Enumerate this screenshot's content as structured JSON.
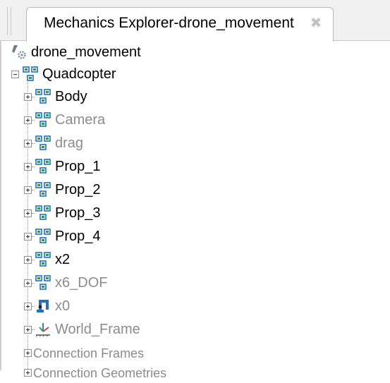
{
  "tab": {
    "title": "Mechanics Explorer-drone_movement",
    "close_glyph": "✖"
  },
  "tree": {
    "root": {
      "label": "drone_movement",
      "icon": "model-gear-icon"
    },
    "group": {
      "label": "Quadcopter",
      "icon": "subsystem-icon",
      "expanded": true
    },
    "children": [
      {
        "label": "Body",
        "icon": "subsystem-icon",
        "active": true
      },
      {
        "label": "Camera",
        "icon": "subsystem-icon",
        "active": false
      },
      {
        "label": "drag",
        "icon": "subsystem-icon",
        "active": false
      },
      {
        "label": "Prop_1",
        "icon": "subsystem-icon",
        "active": true
      },
      {
        "label": "Prop_2",
        "icon": "subsystem-icon",
        "active": true
      },
      {
        "label": "Prop_3",
        "icon": "subsystem-icon",
        "active": true
      },
      {
        "label": "Prop_4",
        "icon": "subsystem-icon",
        "active": true
      },
      {
        "label": "x2",
        "icon": "subsystem-icon",
        "active": true
      },
      {
        "label": "x6_DOF",
        "icon": "subsystem-icon",
        "active": false
      },
      {
        "label": "x0",
        "icon": "robot-arm-icon",
        "active": false
      },
      {
        "label": "World_Frame",
        "icon": "world-frame-icon",
        "active": false
      }
    ],
    "folders": [
      {
        "label": "Connection Frames"
      },
      {
        "label": "Connection Geometries"
      }
    ]
  },
  "colors": {
    "icon_blue": "#1b72c6",
    "icon_green": "#2f9e3a",
    "inactive_text": "#8c8c8c",
    "active_text": "#000000"
  }
}
